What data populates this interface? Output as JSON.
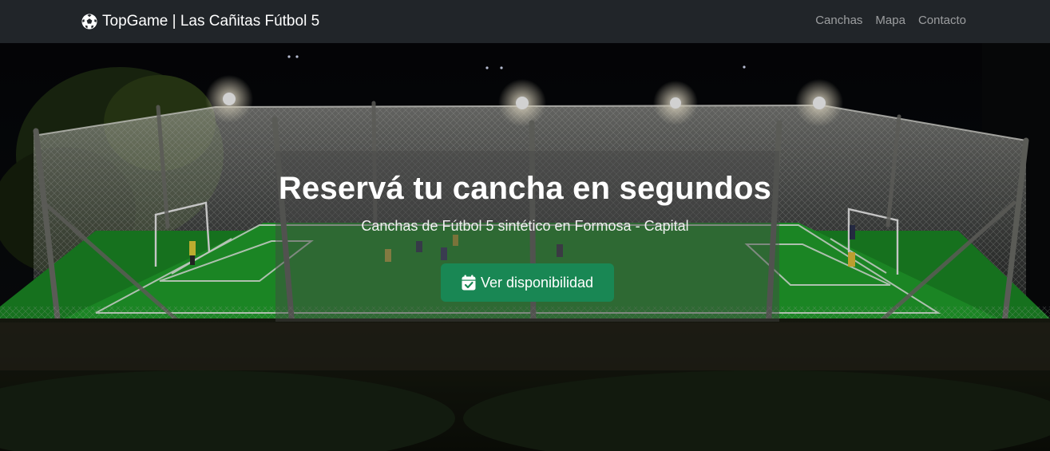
{
  "navbar": {
    "brand": "TopGame | Las Cañitas Fútbol 5",
    "brand_icon": "soccer-ball-icon",
    "links": [
      {
        "label": "Canchas"
      },
      {
        "label": "Mapa"
      },
      {
        "label": "Contacto"
      }
    ]
  },
  "hero": {
    "title": "Reservá tu cancha en segundos",
    "subtitle": "Canchas de Fútbol 5 sintético en Formosa - Capital",
    "cta_label": "Ver disponibilidad",
    "cta_icon": "calendar-check-icon",
    "background_image": "night-aerial-view-of-fenced-five-a-side-pitch",
    "colors": {
      "navbar": "#212529",
      "cta": "#198754",
      "pitch": "#1b8a25"
    }
  }
}
